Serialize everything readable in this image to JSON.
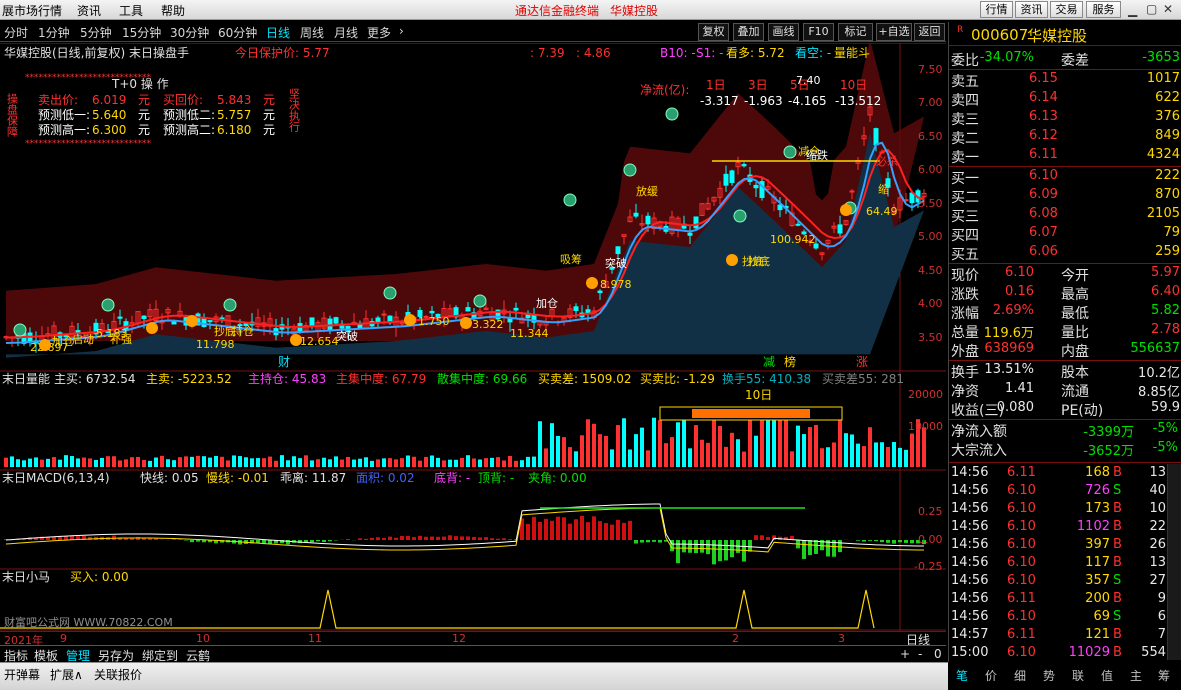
{
  "menubar": {
    "items": [
      "展市场行情",
      "资讯",
      "工具",
      "帮助"
    ],
    "center": [
      "通达信金融终端",
      "华媒控股"
    ],
    "right": [
      "行情",
      "资讯",
      "交易",
      "服务"
    ]
  },
  "periods": {
    "items": [
      "分时",
      "1分钟",
      "5分钟",
      "15分钟",
      "30分钟",
      "60分钟",
      "日线",
      "周线",
      "月线",
      "更多"
    ],
    "active": 6,
    "more_arrow": "›",
    "tools": [
      "复权",
      "叠加",
      "画线",
      "F10",
      "标记",
      "+自选",
      "返回"
    ]
  },
  "chart": {
    "header": {
      "title": "华媒控股(日线,前复权) 末日操盘手",
      "protect": "今日保护价: 5.77",
      "p1": ": 7.39",
      "p2": ": 4.86",
      "b10": "B10: -",
      "s1": "S1: -",
      "kanduo": "看多: 5.72",
      "kankong": "看空: -",
      "liangneng": "量能斗"
    },
    "yaxis": [
      "7.50",
      "7.00",
      "6.50",
      "6.00",
      "5.50",
      "5.00",
      "4.50",
      "4.00",
      "3.50"
    ],
    "t0": {
      "title": "T+0 操 作",
      "side_left": "操盘保障",
      "side_right": "坚决执行",
      "sell_label": "卖出价:",
      "sell_val": "6.019",
      "sell_unit": "元",
      "buy_label": "买回价:",
      "buy_val": "5.843",
      "buy_unit": "元",
      "low1_label": "预测低一:",
      "low1_val": "5.640",
      "low1_unit": "元",
      "low2_label": "预测低二:",
      "low2_val": "5.757",
      "low2_unit": "元",
      "hi1_label": "预测高一:",
      "hi1_val": "6.300",
      "hi1_unit": "元",
      "hi2_label": "预测高二:",
      "hi2_val": "6.180",
      "hi2_unit": "元",
      "stars": "****************************"
    },
    "flow": {
      "label": "净流(亿):",
      "cols": [
        "1日",
        "3日",
        "5日",
        "10日"
      ],
      "vals": [
        "-3.317",
        "-1.963",
        "-4.165",
        "-13.512"
      ]
    },
    "annotations": [
      "7.40",
      "100.942",
      "64.49",
      "8.978",
      "11.344",
      "11.798",
      "1.750",
      "3.322",
      "5.183",
      "12.654",
      "22.897",
      "突破",
      "突破",
      "必杀",
      "缩",
      "加仓",
      "补强",
      "抄底",
      "抄底",
      "吸筹",
      "放缓",
      "减仓",
      "持仓",
      "加仓",
      "抄底",
      "缩跌",
      "启动"
    ],
    "markers": [
      "财",
      "减",
      "榜",
      "涨"
    ],
    "vol": {
      "title": "末日量能",
      "zhumai": "主买: 6732.54",
      "zhumai2": "主卖: -5223.52",
      "zhuchi": "主持仓: 45.83",
      "zhuji": "主集中度: 67.79",
      "sanji": "散集中度: 69.66",
      "maimaicha": "买卖差: 1509.02",
      "maimaibi": "买卖比: -1.29",
      "huanshou": "换手55: 410.38",
      "maimaicha2": "买卖差55: 281",
      "yaxis": [
        "20000",
        "10000"
      ],
      "box_label": "10日"
    },
    "macd": {
      "title": "末日MACD(6,13,4)",
      "kuai": "快线: 0.05",
      "man": "慢线: -0.01",
      "guli": "乖离: 11.87",
      "mianji": "面积: 0.02",
      "dibei": "底背: -",
      "dingbei": "顶背: -",
      "jiajiao": "夹角: 0.00",
      "yaxis": [
        "0.25",
        "0.00",
        "-0.25"
      ]
    },
    "xiaoma": {
      "title": "末日小马",
      "mairu": "买入: 0.00",
      "watermark": "财富吧公式网 WWW.70822.COM"
    },
    "xaxis": {
      "year": "2021年",
      "ticks": [
        "9",
        "10",
        "11",
        "12",
        "2",
        "3"
      ],
      "period": "日线",
      "ctrl": [
        "+",
        "-",
        "0"
      ]
    }
  },
  "panel": {
    "header": {
      "badge": "R",
      "code": "000607",
      "name": "华媒控股"
    },
    "weibi": {
      "label": "委比",
      "val": "-34.07%",
      "label2": "委差",
      "val2": "-3653"
    },
    "asks": [
      {
        "l": "卖五",
        "p": "6.15",
        "v": "1017"
      },
      {
        "l": "卖四",
        "p": "6.14",
        "v": "622"
      },
      {
        "l": "卖三",
        "p": "6.13",
        "v": "376"
      },
      {
        "l": "卖二",
        "p": "6.12",
        "v": "849"
      },
      {
        "l": "卖一",
        "p": "6.11",
        "v": "4324"
      }
    ],
    "bids": [
      {
        "l": "买一",
        "p": "6.10",
        "v": "222"
      },
      {
        "l": "买二",
        "p": "6.09",
        "v": "870"
      },
      {
        "l": "买三",
        "p": "6.08",
        "v": "2105"
      },
      {
        "l": "买四",
        "p": "6.07",
        "v": "79"
      },
      {
        "l": "买五",
        "p": "6.06",
        "v": "259"
      }
    ],
    "quote": [
      {
        "l": "现价",
        "v": "6.10",
        "c": "red",
        "l2": "今开",
        "v2": "5.97",
        "c2": "red"
      },
      {
        "l": "涨跌",
        "v": "0.16",
        "c": "red",
        "l2": "最高",
        "v2": "6.40",
        "c2": "red"
      },
      {
        "l": "涨幅",
        "v": "2.69%",
        "c": "red",
        "l2": "最低",
        "v2": "5.82",
        "c2": "grn"
      },
      {
        "l": "总量",
        "v": "119.6万",
        "c": "yel",
        "l2": "量比",
        "v2": "2.78",
        "c2": "red"
      },
      {
        "l": "外盘",
        "v": "638969",
        "c": "red",
        "l2": "内盘",
        "v2": "556637",
        "c2": "grn"
      }
    ],
    "finance": [
      {
        "l": "换手",
        "v": "13.51%",
        "l2": "股本",
        "v2": "10.2亿"
      },
      {
        "l": "净资",
        "v": "1.41",
        "l2": "流通",
        "v2": "8.85亿"
      },
      {
        "l": "收益(三)",
        "v": "0.080",
        "l2": "PE(动)",
        "v2": "59.9"
      }
    ],
    "flows": [
      {
        "l": "净流入额",
        "v": "-3399万",
        "p": "-5%"
      },
      {
        "l": "大宗流入",
        "v": "-3652万",
        "p": "-5%"
      }
    ],
    "ticks": [
      {
        "t": "14:56",
        "p": "6.11",
        "v": "168",
        "bs": "B",
        "n": "13",
        "vc": "yel"
      },
      {
        "t": "14:56",
        "p": "6.10",
        "v": "726",
        "bs": "S",
        "n": "40",
        "vc": "mag"
      },
      {
        "t": "14:56",
        "p": "6.10",
        "v": "173",
        "bs": "B",
        "n": "10",
        "vc": "yel"
      },
      {
        "t": "14:56",
        "p": "6.10",
        "v": "1102",
        "bs": "B",
        "n": "22",
        "vc": "mag"
      },
      {
        "t": "14:56",
        "p": "6.10",
        "v": "397",
        "bs": "B",
        "n": "26",
        "vc": "yel"
      },
      {
        "t": "14:56",
        "p": "6.10",
        "v": "117",
        "bs": "B",
        "n": "13",
        "vc": "yel"
      },
      {
        "t": "14:56",
        "p": "6.10",
        "v": "357",
        "bs": "S",
        "n": "27",
        "vc": "yel"
      },
      {
        "t": "14:56",
        "p": "6.11",
        "v": "200",
        "bs": "B",
        "n": "9",
        "vc": "yel"
      },
      {
        "t": "14:56",
        "p": "6.10",
        "v": "69",
        "bs": "S",
        "n": "6",
        "vc": "yel"
      },
      {
        "t": "14:57",
        "p": "6.11",
        "v": "121",
        "bs": "B",
        "n": "7",
        "vc": "yel"
      },
      {
        "t": "15:00",
        "p": "6.10",
        "v": "11029",
        "bs": "B",
        "n": "554",
        "vc": "mag"
      }
    ]
  },
  "bottomtabs": {
    "items": [
      "指标",
      "模板",
      "管理",
      "另存为",
      "绑定到",
      "云鹤"
    ],
    "active": 2
  },
  "statusbar": {
    "items": [
      "开弹幕",
      "扩展∧",
      "关联报价"
    ]
  },
  "rtabs": {
    "items": [
      "笔",
      "价",
      "细",
      "势",
      "联",
      "值",
      "主",
      "筹"
    ],
    "active": 0
  },
  "colors": {
    "up": "#ff3030",
    "down": "#00ffff",
    "ma_red": "#ff2020",
    "ma_blue": "#3aa0ff",
    "band_upper": "#5a0a0a",
    "band_lower": "#123045"
  }
}
